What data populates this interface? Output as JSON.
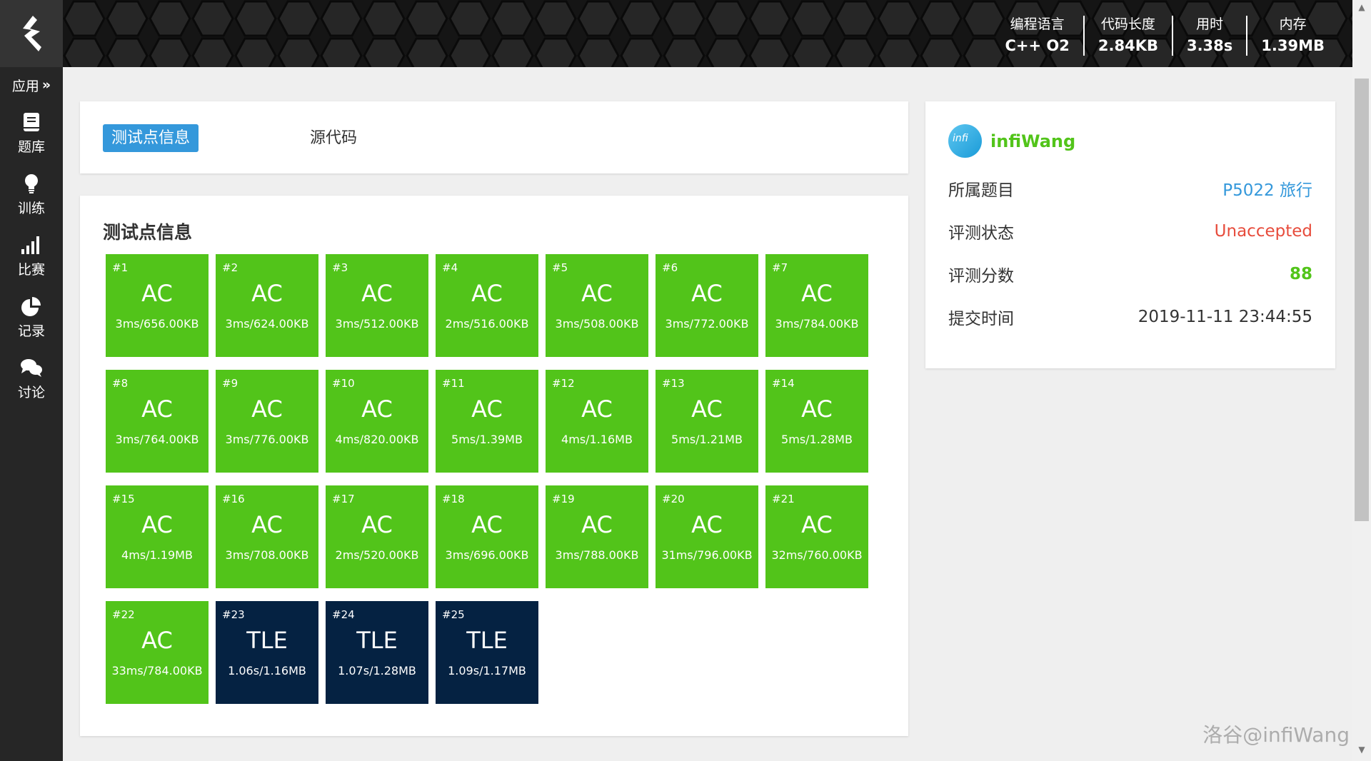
{
  "sidebar": {
    "app_toggle": "应用",
    "items": [
      {
        "label": "题库",
        "icon": "book-icon"
      },
      {
        "label": "训练",
        "icon": "lightbulb-icon"
      },
      {
        "label": "比赛",
        "icon": "bar-chart-icon"
      },
      {
        "label": "记录",
        "icon": "pie-chart-icon"
      },
      {
        "label": "讨论",
        "icon": "chat-icon"
      }
    ]
  },
  "header": {
    "stats": [
      {
        "label": "编程语言",
        "value": "C++ O2"
      },
      {
        "label": "代码长度",
        "value": "2.84KB"
      },
      {
        "label": "用时",
        "value": "3.38s"
      },
      {
        "label": "内存",
        "value": "1.39MB"
      }
    ]
  },
  "tabs": {
    "active": "测试点信息",
    "other": "源代码"
  },
  "tests": {
    "title": "测试点信息",
    "colors": {
      "AC": "#52c41a",
      "TLE": "#052242"
    },
    "cases": [
      {
        "num": "#1",
        "status": "AC",
        "detail": "3ms/656.00KB"
      },
      {
        "num": "#2",
        "status": "AC",
        "detail": "3ms/624.00KB"
      },
      {
        "num": "#3",
        "status": "AC",
        "detail": "3ms/512.00KB"
      },
      {
        "num": "#4",
        "status": "AC",
        "detail": "2ms/516.00KB"
      },
      {
        "num": "#5",
        "status": "AC",
        "detail": "3ms/508.00KB"
      },
      {
        "num": "#6",
        "status": "AC",
        "detail": "3ms/772.00KB"
      },
      {
        "num": "#7",
        "status": "AC",
        "detail": "3ms/784.00KB"
      },
      {
        "num": "#8",
        "status": "AC",
        "detail": "3ms/764.00KB"
      },
      {
        "num": "#9",
        "status": "AC",
        "detail": "3ms/776.00KB"
      },
      {
        "num": "#10",
        "status": "AC",
        "detail": "4ms/820.00KB"
      },
      {
        "num": "#11",
        "status": "AC",
        "detail": "5ms/1.39MB"
      },
      {
        "num": "#12",
        "status": "AC",
        "detail": "4ms/1.16MB"
      },
      {
        "num": "#13",
        "status": "AC",
        "detail": "5ms/1.21MB"
      },
      {
        "num": "#14",
        "status": "AC",
        "detail": "5ms/1.28MB"
      },
      {
        "num": "#15",
        "status": "AC",
        "detail": "4ms/1.19MB"
      },
      {
        "num": "#16",
        "status": "AC",
        "detail": "3ms/708.00KB"
      },
      {
        "num": "#17",
        "status": "AC",
        "detail": "2ms/520.00KB"
      },
      {
        "num": "#18",
        "status": "AC",
        "detail": "3ms/696.00KB"
      },
      {
        "num": "#19",
        "status": "AC",
        "detail": "3ms/788.00KB"
      },
      {
        "num": "#20",
        "status": "AC",
        "detail": "31ms/796.00KB"
      },
      {
        "num": "#21",
        "status": "AC",
        "detail": "32ms/760.00KB"
      },
      {
        "num": "#22",
        "status": "AC",
        "detail": "33ms/784.00KB"
      },
      {
        "num": "#23",
        "status": "TLE",
        "detail": "1.06s/1.16MB"
      },
      {
        "num": "#24",
        "status": "TLE",
        "detail": "1.07s/1.28MB"
      },
      {
        "num": "#25",
        "status": "TLE",
        "detail": "1.09s/1.17MB"
      }
    ]
  },
  "info": {
    "avatar_text": "infi",
    "username": "infiWang",
    "rows": [
      {
        "label": "所属题目",
        "value": "P5022 旅行",
        "color": "#3498db"
      },
      {
        "label": "评测状态",
        "value": "Unaccepted",
        "color": "#e74c3c"
      },
      {
        "label": "评测分数",
        "value": "88",
        "color": "#52c41a"
      },
      {
        "label": "提交时间",
        "value": "2019-11-11 23:44:55",
        "color": "#333333"
      }
    ]
  },
  "watermark": "洛谷@infiWang"
}
